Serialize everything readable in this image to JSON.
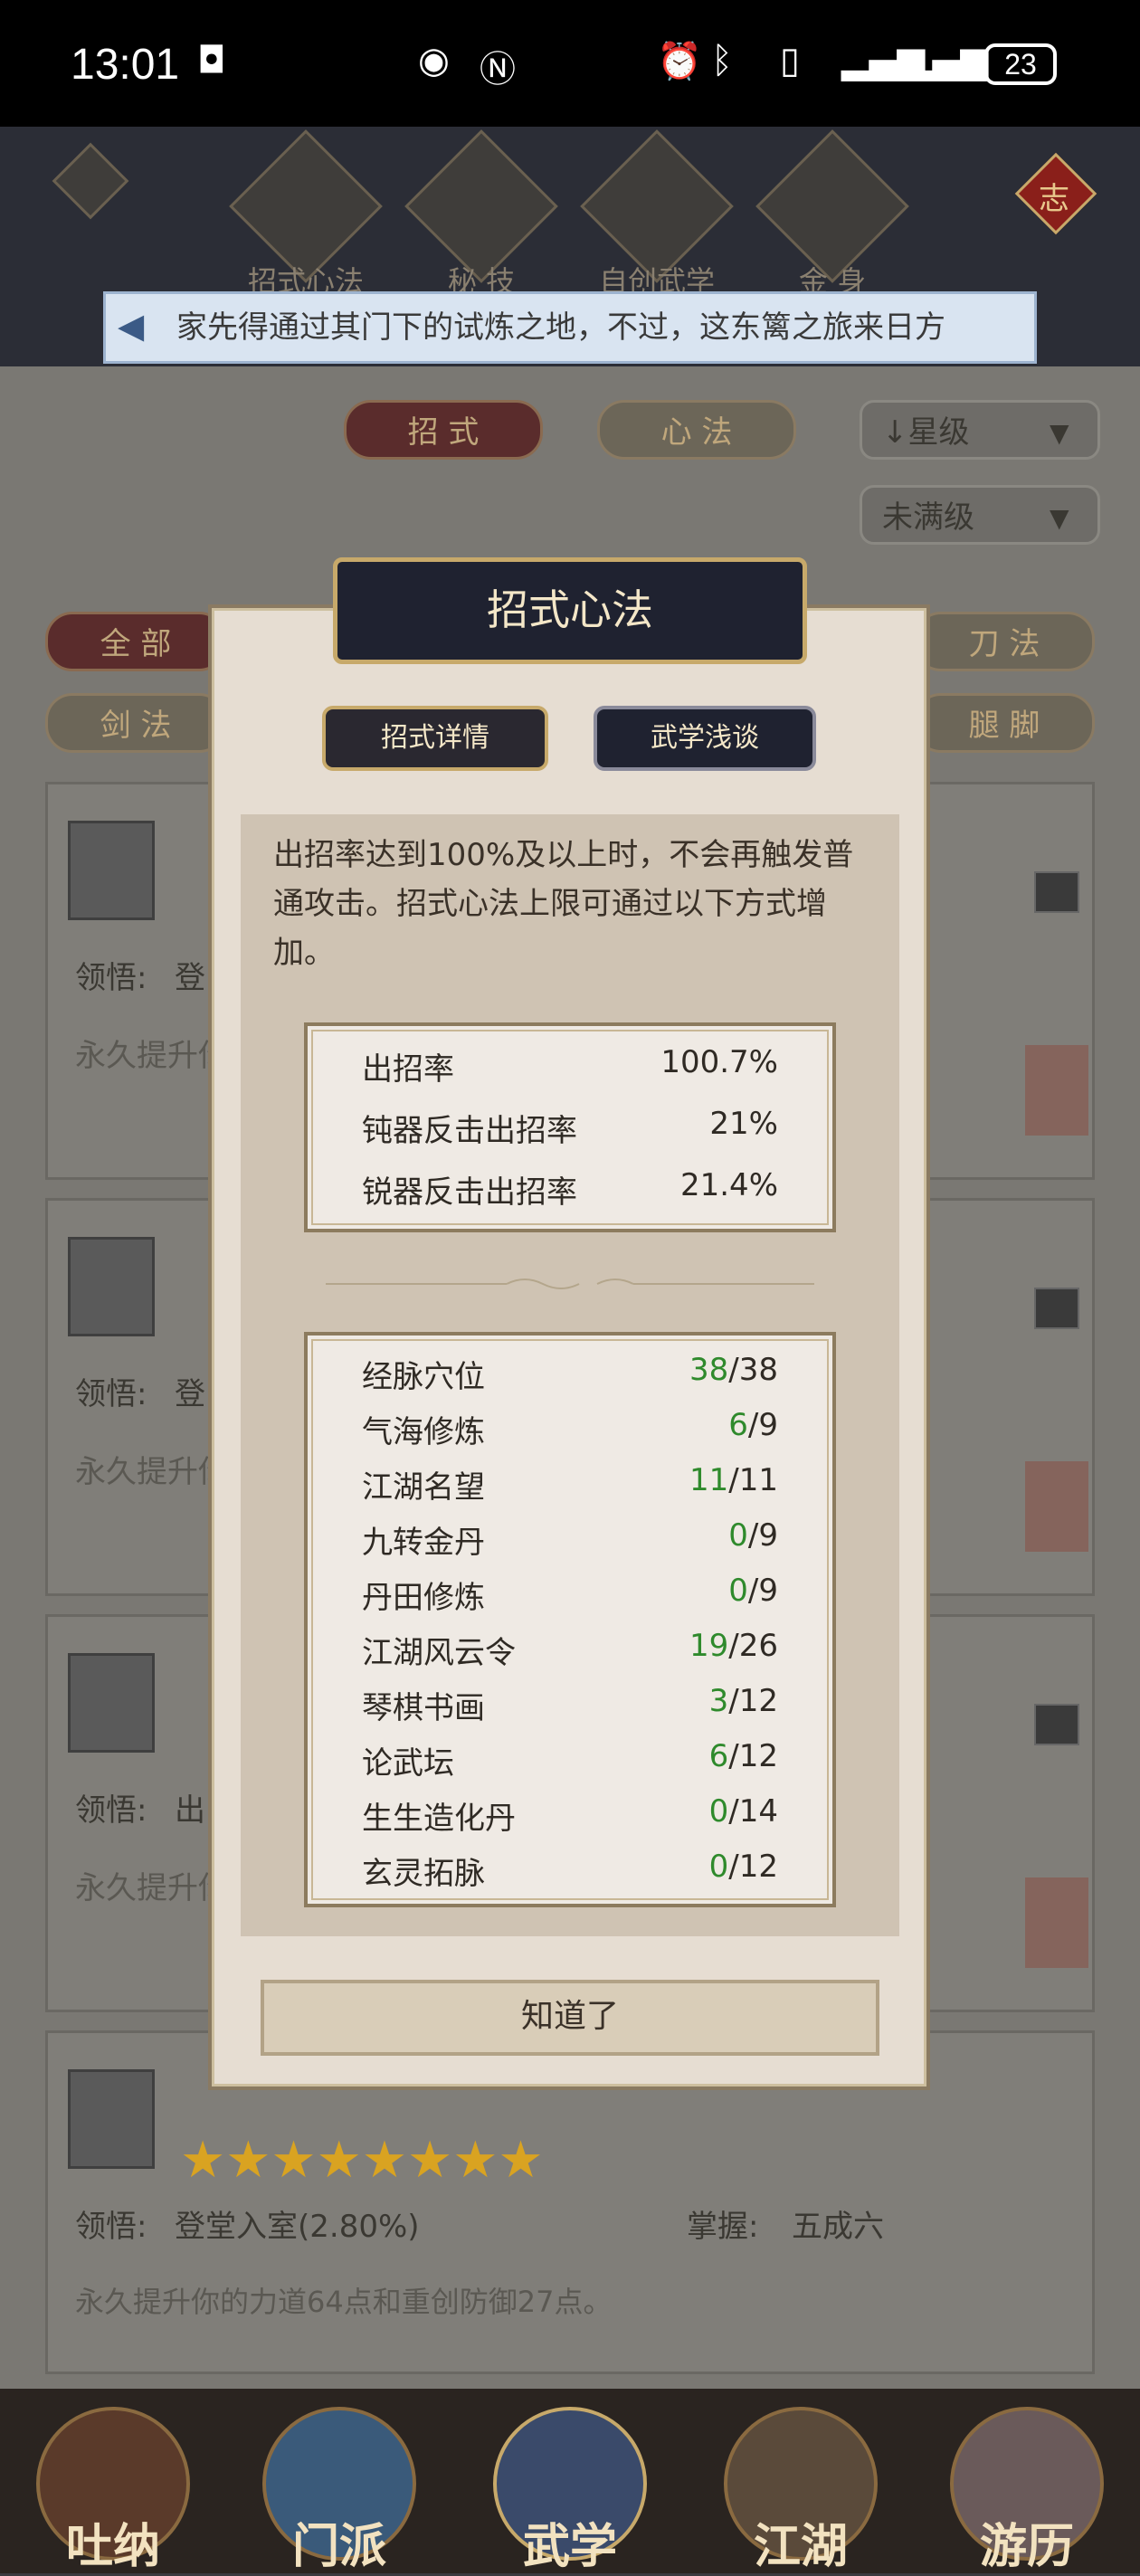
{
  "status_bar": {
    "time": "13:01",
    "battery": "23"
  },
  "top_nav": {
    "items": [
      "招式心法",
      "秘 技",
      "自创武学",
      "金 身"
    ],
    "emblem": "志"
  },
  "marquee": {
    "text": "家先得通过其门下的试炼之地，不过，这东篱之旅来日方"
  },
  "background": {
    "tabs": [
      "招 式",
      "心 法"
    ],
    "sort_select": "↓星级",
    "level_select": "未满级",
    "filters": [
      "全 部",
      "剑 法",
      "刀 法",
      "腿 脚"
    ],
    "card_label_prefix": [
      "领悟:",
      "领悟:",
      "领悟:"
    ],
    "card_label_partial": [
      "登",
      "登",
      "出"
    ],
    "card_text_partial": "永久提升你",
    "last_card": {
      "comprehension": "领悟:",
      "comprehension_value": "登堂入室(2.80%)",
      "mastery": "掌握:",
      "mastery_value": "五成六",
      "description": "永久提升你的力道64点和重创防御27点。"
    }
  },
  "bottom_nav": {
    "items": [
      "吐纳",
      "门派",
      "武学",
      "江湖",
      "游历"
    ]
  },
  "modal": {
    "title": "招式心法",
    "tabs": [
      "招式详情",
      "武学浅谈"
    ],
    "description": "出招率达到100%及以上时，不会再触发普通攻击。招式心法上限可通过以下方式增加。",
    "stats": [
      {
        "label": "出招率",
        "value": "100.7%"
      },
      {
        "label": "钝器反击出招率",
        "value": "21%"
      },
      {
        "label": "锐器反击出招率",
        "value": "21.4%"
      }
    ],
    "sources": [
      {
        "label": "经脉穴位",
        "current": "38",
        "max": "/38"
      },
      {
        "label": "气海修炼",
        "current": "6",
        "max": "/9"
      },
      {
        "label": "江湖名望",
        "current": "11",
        "max": "/11"
      },
      {
        "label": "九转金丹",
        "current": "0",
        "max": "/9"
      },
      {
        "label": "丹田修炼",
        "current": "0",
        "max": "/9"
      },
      {
        "label": "江湖风云令",
        "current": "19",
        "max": "/26"
      },
      {
        "label": "琴棋书画",
        "current": "3",
        "max": "/12"
      },
      {
        "label": "论武坛",
        "current": "6",
        "max": "/12"
      },
      {
        "label": "生生造化丹",
        "current": "0",
        "max": "/14"
      },
      {
        "label": "玄灵拓脉",
        "current": "0",
        "max": "/12"
      }
    ],
    "confirm_label": "知道了"
  },
  "colors": {
    "accent_gold": "#c7a96a",
    "green": "#2f8a2c",
    "title_bg": "#1f2230"
  }
}
